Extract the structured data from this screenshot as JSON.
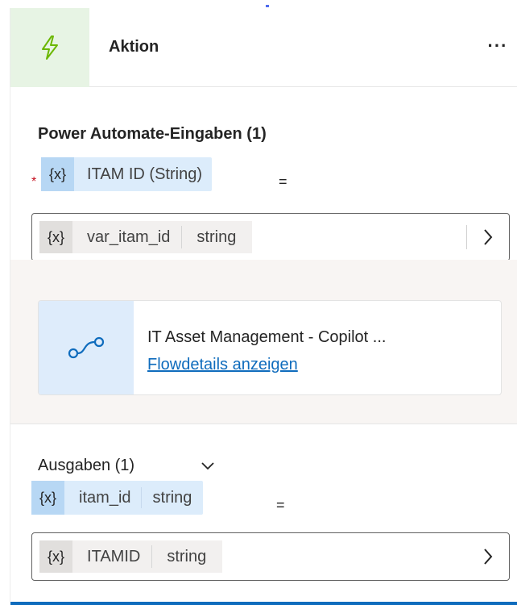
{
  "header": {
    "title": "Aktion",
    "more_label": "···"
  },
  "inputs_section": {
    "title": "Power Automate-Eingaben (1)",
    "required_mark": "*",
    "parameter": {
      "tag": "{x}",
      "name": "ITAM ID (String)",
      "equals": "="
    },
    "value_field": {
      "tag": "{x}",
      "name": "var_itam_id",
      "type": "string"
    }
  },
  "flow": {
    "title": "IT Asset Management - Copilot ...",
    "link_label": "Flowdetails anzeigen"
  },
  "outputs_section": {
    "title": "Ausgaben (1)",
    "parameter": {
      "tag": "{x}",
      "name": "itam_id",
      "type": "string",
      "equals": "="
    },
    "value_field": {
      "tag": "{x}",
      "name": "ITAMID",
      "type": "string"
    }
  },
  "colors": {
    "action_icon": "#6bb700",
    "flow_icon": "#0f6cbd",
    "accent": "#0f6cbd",
    "required": "#c50f1f"
  },
  "icons": {
    "action": "lightning-icon",
    "flow": "flow-connector-icon",
    "field_arrow": "chevron-right-icon",
    "outputs_toggle": "chevron-down-icon"
  }
}
